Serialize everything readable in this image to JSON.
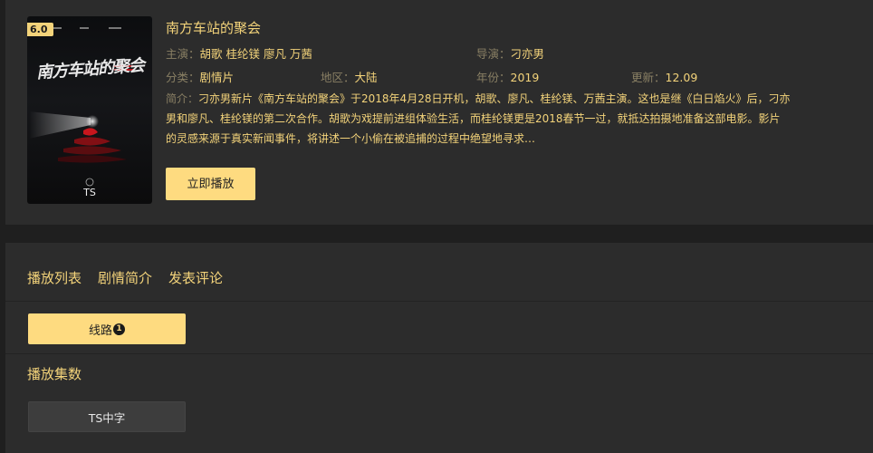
{
  "movie": {
    "score": "6.0",
    "poster_title": "南方车站的聚会",
    "poster_quality": "TS",
    "title": "南方车站的聚会",
    "cast_label": "主演：",
    "cast": "胡歌 桂纶镁 廖凡 万茜",
    "director_label": "导演：",
    "director": "刁亦男",
    "genre_label": "分类：",
    "genre": "剧情片",
    "region_label": "地区：",
    "region": "大陆",
    "year_label": "年份：",
    "year": "2019",
    "update_label": "更新：",
    "update": "12.09",
    "synopsis_label": "简介：",
    "synopsis": "刁亦男新片《南方车站的聚会》于2018年4月28日开机，胡歌、廖凡、桂纶镁、万茜主演。这也是继《白日焰火》后，刁亦男和廖凡、桂纶镁的第二次合作。胡歌为戏提前进组体验生活，而桂纶镁更是2018春节一过，就抵达拍摄地准备这部电影。影片的灵感来源于真实新闻事件，将讲述一个小偷在被追捕的过程中绝望地寻求…",
    "play_button": "立即播放"
  },
  "tabs": [
    "播放列表",
    "剧情简介",
    "发表评论"
  ],
  "routes": {
    "label": "线路",
    "number": "1"
  },
  "episodes": {
    "title": "播放集数",
    "items": [
      "TS中字"
    ]
  },
  "colors": {
    "accent": "#f3d37a",
    "button": "#fedb80",
    "panel": "#2c2c2c",
    "background": "#1f1f1f"
  }
}
